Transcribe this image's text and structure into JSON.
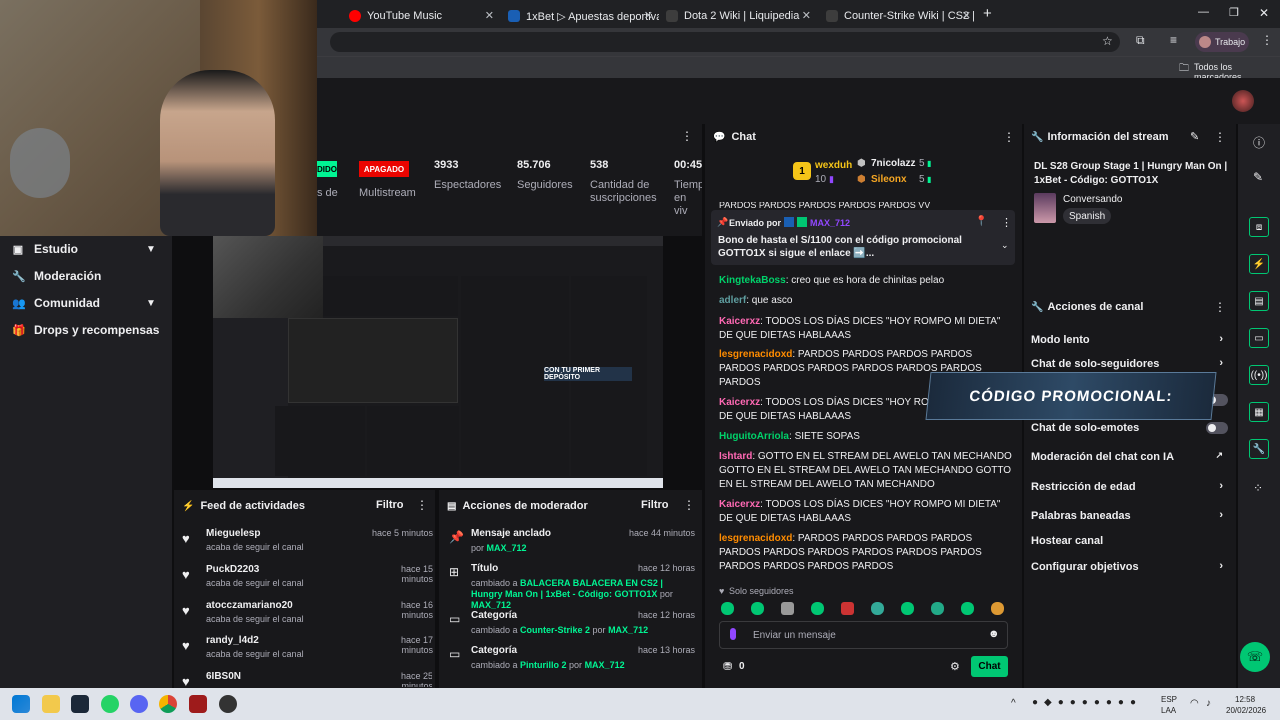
{
  "browser": {
    "tabs": [
      {
        "title": "YouTube Music",
        "color": "#ff0000"
      },
      {
        "title": "1xBet ▷ Apuestas deportivas o",
        "color": "#1a5fb4"
      },
      {
        "title": "Dota 2 Wiki | Liquipedia",
        "color": "#3b3b3b"
      },
      {
        "title": "Counter-Strike Wiki | CS2 | Liqu",
        "color": "#3b3b3b"
      }
    ],
    "new_tab": "+",
    "profile_label": "Trabajo",
    "bookmarks_label": "Todos los marcadores"
  },
  "leftnav": {
    "items": [
      {
        "label": "Estudio",
        "icon": "camera-icon",
        "chevron": true
      },
      {
        "label": "Moderación",
        "icon": "wrench-icon",
        "chevron": false
      },
      {
        "label": "Comunidad",
        "icon": "people-icon",
        "chevron": true
      },
      {
        "label": "Drops y recompensas",
        "icon": "gift-icon",
        "chevron": false
      }
    ]
  },
  "stats": {
    "live_badge": "DIDO",
    "live_label": "s de",
    "multistream_badge": "APAGADO",
    "multistream_label": "Multistream",
    "items": [
      {
        "value": "3933",
        "label": "Espectadores"
      },
      {
        "value": "85.706",
        "label": "Seguidores"
      },
      {
        "value": "538",
        "label": "Cantidad de suscripciones"
      },
      {
        "value": "00:45:",
        "label": "Tiemp en viv"
      }
    ]
  },
  "preview": {
    "promo_text": "CON TU PRIMER DEPÓSITO"
  },
  "feed": {
    "title": "Feed de actividades",
    "filter": "Filtro",
    "items": [
      {
        "name": "Mieguelesp",
        "sub": "acaba de seguir el canal",
        "time": "hace 5 minutos"
      },
      {
        "name": "PuckD2203",
        "sub": "acaba de seguir el canal",
        "time": "hace 15 minutos"
      },
      {
        "name": "atocczamariano20",
        "sub": "acaba de seguir el canal",
        "time": "hace 16 minutos"
      },
      {
        "name": "randy_l4d2",
        "sub": "acaba de seguir el canal",
        "time": "hace 17 minutos"
      },
      {
        "name": "6IBS0N",
        "sub": "",
        "time": "hace 25 minutos"
      }
    ]
  },
  "modactions": {
    "title": "Acciones de moderador",
    "filter": "Filtro",
    "items": [
      {
        "name": "Mensaje anclado",
        "time": "hace 44 minutos",
        "pre": "por ",
        "val": "MAX_712",
        "mid": "",
        "by": ""
      },
      {
        "name": "Título",
        "time": "hace 12 horas",
        "pre": "cambiado a ",
        "val": "BALACERA BALACERA EN CS2 | Hungry Man On | 1xBet - Código: GOTTO1X",
        "mid": " por ",
        "by": "MAX_712"
      },
      {
        "name": "Categoría",
        "time": "hace 12 horas",
        "pre": "cambiado a ",
        "val": "Counter-Strike 2",
        "mid": " por ",
        "by": "MAX_712"
      },
      {
        "name": "Categoría",
        "time": "hace 13 horas",
        "pre": "cambiado a ",
        "val": "Pinturillo 2",
        "mid": " por ",
        "by": "MAX_712"
      }
    ]
  },
  "chat": {
    "title": "Chat",
    "leaders": [
      {
        "rank": "1",
        "name": "wexduh",
        "count": "10"
      },
      {
        "name": "7nicolazz",
        "count": "5"
      },
      {
        "name": "Sileonx",
        "count": "5"
      }
    ],
    "top_cut": "PARDOS PARDOS PARDOS PARDOS PARDOS VV",
    "pinned": {
      "sent_by": "Enviado por",
      "user": "MAX_712",
      "text": "Bono de hasta el S/1100 con el código promocional GOTTO1X si sigue el enlace ➡️..."
    },
    "messages": [
      {
        "user": "KingtekaBoss",
        "color": "#00d26a",
        "text": "creo que es hora de chinitas pelao"
      },
      {
        "user": "adlerf",
        "color": "#5f9ea0",
        "text": "que asco"
      },
      {
        "user": "Kaicerxz",
        "color": "#ff69b4",
        "text": "TODOS LOS DÍAS DICES \"HOY ROMPO MI DIETA\" DE QUE DIETAS HABLAAAS"
      },
      {
        "user": "lesgrenacidoxd",
        "color": "#ff8c00",
        "text": "PARDOS PARDOS PARDOS PARDOS PARDOS PARDOS PARDOS PARDOS PARDOS PARDOS PARDOS"
      },
      {
        "user": "Kaicerxz",
        "color": "#ff69b4",
        "text": "TODOS LOS DÍAS DICES \"HOY ROMPO MI DIETA\" DE QUE DIETAS HABLAAAS"
      },
      {
        "user": "HuguitoArriola",
        "color": "#00d26a",
        "text": "SIETE SOPAS"
      },
      {
        "user": "Ishtard",
        "color": "#ff69b4",
        "text": "GOTTO EN EL STREAM DEL AWELO TAN MECHANDO GOTTO EN EL STREAM DEL AWELO TAN MECHANDO GOTTO EN EL STREAM DEL AWELO TAN MECHANDO"
      },
      {
        "user": "Kaicerxz",
        "color": "#ff69b4",
        "text": "TODOS LOS DÍAS DICES \"HOY ROMPO MI DIETA\" DE QUE DIETAS HABLAAAS"
      },
      {
        "user": "lesgrenacidoxd",
        "color": "#ff8c00",
        "text": "PARDOS PARDOS PARDOS PARDOS PARDOS PARDOS PARDOS PARDOS PARDOS PARDOS PARDOS PARDOS PARDOS PARDOS"
      }
    ],
    "followers_only": "Solo seguidores",
    "input_placeholder": "Enviar un mensaje",
    "points": "0",
    "send": "Chat"
  },
  "info": {
    "title": "Información del stream",
    "stream_title": "DL S28 Group Stage 1 | Hungry Man On | 1xBet - Código: GOTTO1X",
    "category": "Conversando",
    "tag": "Spanish"
  },
  "actions": {
    "title": "Acciones de canal",
    "items": [
      {
        "label": "Modo lento",
        "control": "chevron"
      },
      {
        "label": "Chat de solo-seguidores",
        "control": "chevron"
      },
      {
        "label": "",
        "control": "toggle"
      },
      {
        "label": "Chat de solo-emotes",
        "control": "toggle"
      },
      {
        "label": "Moderación del chat con IA",
        "control": "link"
      },
      {
        "label": "Restricción de edad",
        "control": "chevron"
      },
      {
        "label": "Palabras baneadas",
        "control": "chevron"
      },
      {
        "label": "Hostear canal",
        "control": "none"
      },
      {
        "label": "Configurar objetivos",
        "control": "chevron"
      }
    ]
  },
  "promo_overlay": "CÓDIGO PROMOCIONAL:",
  "taskbar": {
    "lang": "ESP",
    "lang2": "LAA",
    "time": "12:58",
    "date": "20/02/2026"
  },
  "colors": {
    "accent": "#00f593",
    "purple": "#9147ff",
    "live_red": "#eb0400"
  }
}
